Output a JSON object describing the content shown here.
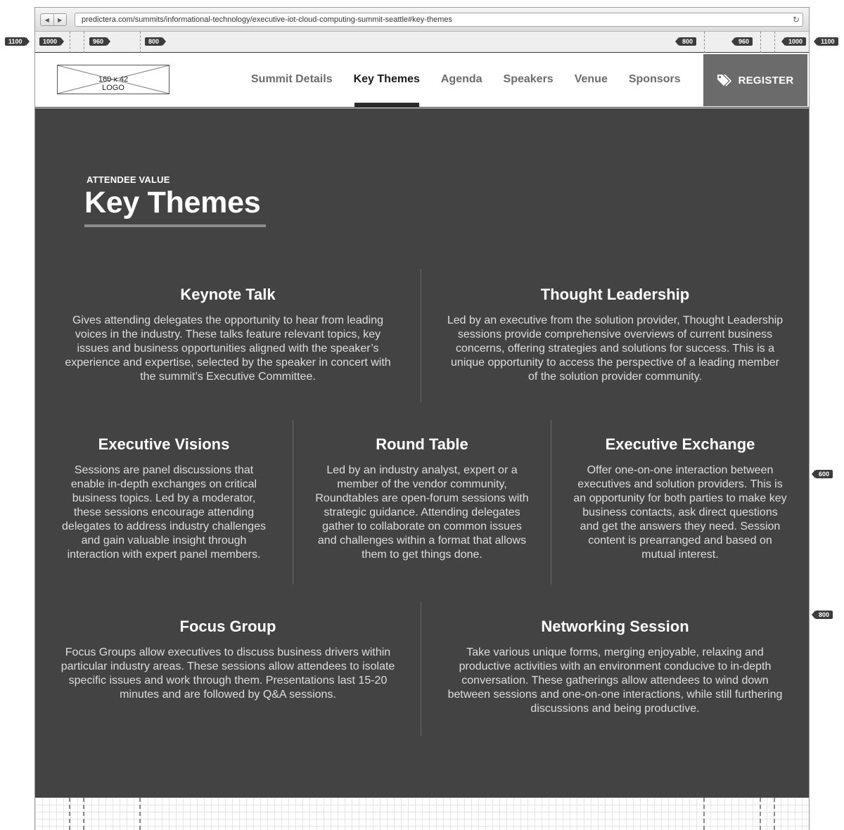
{
  "browser": {
    "url": "predictera.com/summits/informational-technology/executive-iot-cloud-computing-summit-seattle#key-themes",
    "back_glyph": "◀",
    "forward_glyph": "▶",
    "reload_glyph": "↻"
  },
  "breakpoints": {
    "left": [
      "1100",
      "1000",
      "960",
      "800"
    ],
    "right": [
      "800",
      "960",
      "1000",
      "1100"
    ],
    "side": [
      "600",
      "800"
    ]
  },
  "header": {
    "logo_size": "160 x 42",
    "logo_label": "LOGO",
    "nav": [
      "Summit Details",
      "Key Themes",
      "Agenda",
      "Speakers",
      "Venue",
      "Sponsors"
    ],
    "active_nav": "Key Themes",
    "register_label": "REGISTER"
  },
  "section": {
    "eyebrow": "ATTENDEE VALUE",
    "title": "Key Themes",
    "themes": [
      {
        "title": "Keynote Talk",
        "description": "Gives attending delegates the opportunity to hear from leading voices in the industry. These talks feature relevant topics, key issues and business opportunities aligned with the speaker’s experience and expertise, selected by the speaker in concert with the summit’s Executive Committee."
      },
      {
        "title": "Thought Leadership",
        "description": "Led by an executive from the solution provider, Thought Leadership sessions provide comprehensive overviews of current business concerns, offering strategies and solutions for success. This is a unique opportunity to access the perspective of a leading member of the solution provider community."
      },
      {
        "title": "Executive Visions",
        "description": "Sessions are panel discussions that enable in-depth exchanges on critical business topics. Led by a moderator, these sessions encourage attending delegates to address industry challenges and gain valuable insight through interaction with expert panel members."
      },
      {
        "title": "Round Table",
        "description": "Led by an industry analyst, expert or a member of the vendor community, Roundtables are open-forum sessions with strategic guidance. Attending delegates gather to collaborate on common issues and challenges within a format that allows them to get things done."
      },
      {
        "title": "Executive Exchange",
        "description": "Offer one-on-one interaction between executives and solution providers. This is an opportunity for both parties to make key business contacts, ask direct questions and get the answers they need. Session content is prearranged and based on mutual interest."
      },
      {
        "title": "Focus Group",
        "description": "Focus Groups allow executives to discuss business drivers within particular industry areas. These sessions allow attendees to isolate specific issues and work through them. Presentations last 15-20 minutes and are followed by Q&A sessions."
      },
      {
        "title": "Networking Session",
        "description": "Take various unique forms, merging enjoyable, relaxing and productive activities with an environment conducive to in-depth conversation. These gatherings allow attendees to wind down between sessions and one-on-one interactions, while still furthering discussions and being productive."
      }
    ]
  }
}
